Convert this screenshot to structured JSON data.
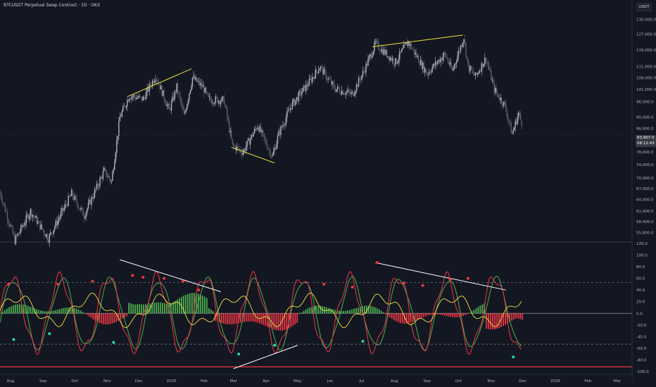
{
  "header": {
    "symbol_title": "BTCUSDT Perpetual Swap Contract · 1D · OKX",
    "currency_button": "USDT"
  },
  "price_tag": {
    "price": "83,907.0",
    "countdown": "08:12:43"
  },
  "price_axis": {
    "labels": [
      "135,000.0",
      "127,000.0",
      "119,000.0",
      "111,000.0",
      "106,000.0",
      "101,000.0",
      "96,000.0",
      "90,000.0",
      "86,000.0",
      "82,000.0",
      "78,000.0",
      "74,000.0",
      "70,000.0",
      "67,000.0",
      "64,000.0",
      "61,000.0",
      "58,400.0",
      "55,800.0"
    ]
  },
  "osc_axis": {
    "labels": [
      "120.0",
      "100.0",
      "80.0",
      "60.0",
      "40.0",
      "20.0",
      "0.0",
      "-20.0",
      "-40.0",
      "-60.0",
      "-80.0",
      "-100.0"
    ]
  },
  "time_axis": {
    "labels": [
      "Aug",
      "Sep",
      "Oct",
      "Nov",
      "Dec",
      "2025",
      "Feb",
      "Mar",
      "Apr",
      "May",
      "Jun",
      "Jul",
      "Aug",
      "Sep",
      "Oct",
      "Nov",
      "Dec",
      "2026",
      "Feb",
      "Mar"
    ]
  },
  "chart_data": [
    {
      "type": "candlestick",
      "title": "BTCUSDT Perpetual Swap Contract · 1D · OKX",
      "ylim": [
        54000,
        138000
      ],
      "ylog": true,
      "x_range": [
        "2024-07-22",
        "2026-03-15"
      ],
      "anchors": [
        [
          "2024-07-22",
          66000
        ],
        [
          "2024-08-05",
          54000
        ],
        [
          "2024-08-20",
          61000
        ],
        [
          "2024-09-06",
          54500
        ],
        [
          "2024-09-28",
          65500
        ],
        [
          "2024-10-10",
          60000
        ],
        [
          "2024-10-29",
          72000
        ],
        [
          "2024-11-05",
          69000
        ],
        [
          "2024-11-13",
          90000
        ],
        [
          "2024-11-22",
          98500
        ],
        [
          "2024-12-05",
          97000
        ],
        [
          "2024-12-17",
          107000
        ],
        [
          "2024-12-30",
          92500
        ],
        [
          "2025-01-06",
          102000
        ],
        [
          "2025-01-13",
          90500
        ],
        [
          "2025-01-21",
          106000
        ],
        [
          "2025-01-31",
          102000
        ],
        [
          "2025-02-05",
          97000
        ],
        [
          "2025-02-20",
          96500
        ],
        [
          "2025-02-28",
          80000
        ],
        [
          "2025-03-10",
          78000
        ],
        [
          "2025-03-24",
          87000
        ],
        [
          "2025-04-07",
          76500
        ],
        [
          "2025-04-13",
          84000
        ],
        [
          "2025-04-25",
          94500
        ],
        [
          "2025-05-12",
          104000
        ],
        [
          "2025-05-22",
          111000
        ],
        [
          "2025-06-05",
          101500
        ],
        [
          "2025-06-22",
          99000
        ],
        [
          "2025-07-03",
          109000
        ],
        [
          "2025-07-14",
          122000
        ],
        [
          "2025-08-02",
          113000
        ],
        [
          "2025-08-14",
          123000
        ],
        [
          "2025-09-01",
          108000
        ],
        [
          "2025-09-18",
          117000
        ],
        [
          "2025-09-25",
          109000
        ],
        [
          "2025-10-06",
          125500
        ],
        [
          "2025-10-10",
          111000
        ],
        [
          "2025-10-17",
          106500
        ],
        [
          "2025-10-27",
          115000
        ],
        [
          "2025-11-04",
          101000
        ],
        [
          "2025-11-14",
          94500
        ],
        [
          "2025-11-21",
          84000
        ],
        [
          "2025-11-27",
          91500
        ],
        [
          "2025-11-30",
          88000
        ]
      ],
      "trend_lines": [
        {
          "color": "#f2e33c",
          "from": [
            "2024-11-20",
            98000
          ],
          "to": [
            "2025-01-20",
            110000
          ]
        },
        {
          "color": "#f2e33c",
          "from": [
            "2025-02-27",
            79500
          ],
          "to": [
            "2025-04-09",
            74500
          ]
        },
        {
          "color": "#f2e33c",
          "from": [
            "2025-07-11",
            120500
          ],
          "to": [
            "2025-10-05",
            126500
          ]
        }
      ],
      "last_price": 83907.0,
      "candle_up_color": "#b2b5be",
      "candle_down_color": "#5d606b"
    },
    {
      "type": "line",
      "ylim": [
        -100,
        120
      ],
      "x_range": [
        "2024-07-22",
        "2026-03-15"
      ],
      "levels": [
        {
          "value": 53,
          "style": "dashed"
        },
        {
          "value": 0,
          "style": "solid"
        },
        {
          "value": -53,
          "style": "dashed"
        },
        {
          "value": -92,
          "style": "solid-red"
        }
      ],
      "series": [],
      "histogram_colors": {
        "positive": "#4caf50",
        "negative": "#f23645"
      },
      "line_colors": {
        "fast": "#f23645",
        "slow": "#4caf50",
        "signal": "#f2e33c"
      },
      "divergence_lines": [
        {
          "color": "#ffffff",
          "from": [
            "2024-11-13",
            92
          ],
          "to": [
            "2025-02-17",
            37
          ]
        },
        {
          "color": "#ffffff",
          "from": [
            "2025-03-01",
            -95
          ],
          "to": [
            "2025-05-01",
            -55
          ]
        },
        {
          "color": "#ffffff",
          "from": [
            "2025-07-14",
            87
          ],
          "to": [
            "2025-11-15",
            40
          ]
        }
      ],
      "markers_top": [
        [
          "2024-07-30",
          50
        ],
        [
          "2024-09-15",
          50
        ],
        [
          "2024-10-18",
          55
        ],
        [
          "2024-11-25",
          65
        ],
        [
          "2024-12-05",
          62
        ],
        [
          "2024-12-25",
          60
        ],
        [
          "2025-01-12",
          55
        ],
        [
          "2025-01-27",
          40
        ],
        [
          "2025-05-26",
          50
        ],
        [
          "2025-06-22",
          45
        ],
        [
          "2025-07-16",
          87
        ],
        [
          "2025-08-10",
          52
        ],
        [
          "2025-08-28",
          48
        ],
        [
          "2025-09-23",
          58
        ],
        [
          "2025-10-10",
          60
        ]
      ],
      "markers_bottom": [
        [
          "2024-08-04",
          -45
        ],
        [
          "2024-09-07",
          -35
        ],
        [
          "2024-11-07",
          -50
        ],
        [
          "2025-03-06",
          -70
        ],
        [
          "2025-04-09",
          -55
        ],
        [
          "2025-07-02",
          -48
        ],
        [
          "2025-11-22",
          -75
        ]
      ]
    }
  ]
}
